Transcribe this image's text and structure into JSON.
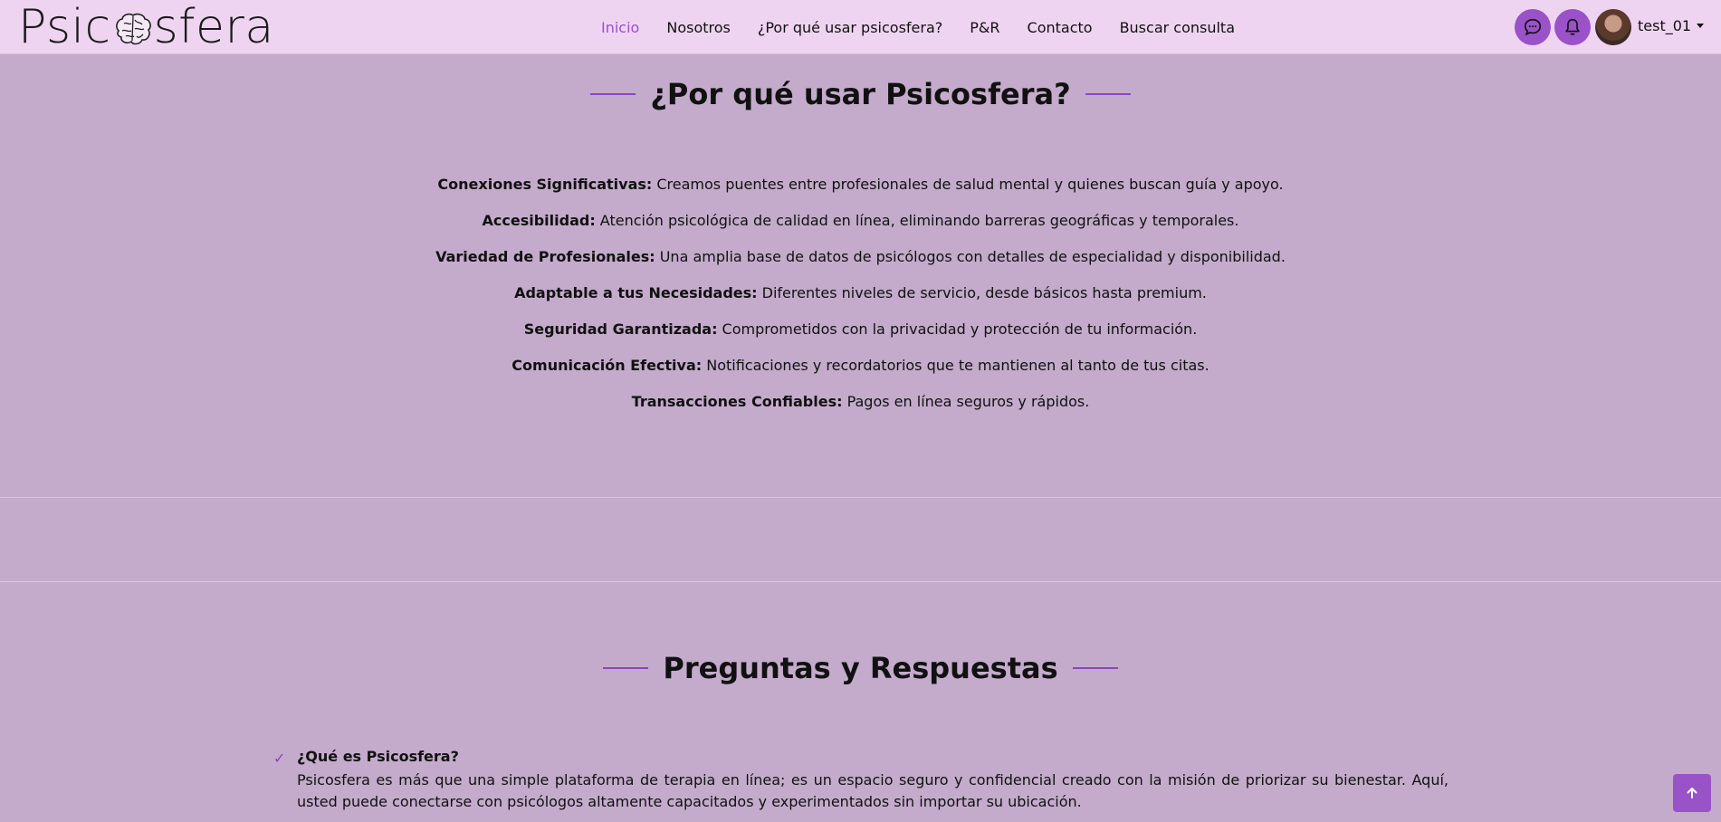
{
  "header": {
    "logo_left": "Psic",
    "logo_right": "sfera",
    "nav": [
      "Inicio",
      "Nosotros",
      "¿Por qué usar psicosfera?",
      "P&R",
      "Contacto",
      "Buscar consulta"
    ],
    "active_nav": "Inicio",
    "username": "test_01",
    "icons": [
      "chat-icon",
      "bell-icon",
      "avatar",
      "caret-down-icon"
    ]
  },
  "why": {
    "title": "¿Por qué usar Psicosfera?",
    "items": [
      {
        "label": "Conexiones Significativas:",
        "text": " Creamos puentes entre profesionales de salud mental y quienes buscan guía y apoyo."
      },
      {
        "label": "Accesibilidad:",
        "text": " Atención psicológica de calidad en línea, eliminando barreras geográficas y temporales."
      },
      {
        "label": "Variedad de Profesionales:",
        "text": " Una amplia base de datos de psicólogos con detalles de especialidad y disponibilidad."
      },
      {
        "label": "Adaptable a tus Necesidades:",
        "text": " Diferentes niveles de servicio, desde básicos hasta premium."
      },
      {
        "label": "Seguridad Garantizada:",
        "text": " Comprometidos con la privacidad y protección de tu información."
      },
      {
        "label": "Comunicación Efectiva:",
        "text": " Notificaciones y recordatorios que te mantienen al tanto de tus citas."
      },
      {
        "label": "Transacciones Confiables:",
        "text": " Pagos en línea seguros y rápidos."
      }
    ]
  },
  "faq": {
    "title": "Preguntas y Respuestas",
    "items": [
      {
        "question": "¿Qué es Psicosfera?",
        "answer": "Psicosfera es más que una simple plataforma de terapia en línea; es un espacio seguro y confidencial creado con la misión de priorizar su bienestar. Aquí, usted puede conectarse con psicólogos altamente capacitados y experimentados sin importar su ubicación."
      }
    ]
  },
  "colors": {
    "accent": "#9a52c8",
    "background": "#c4abcb",
    "header": "#efd4f2"
  }
}
